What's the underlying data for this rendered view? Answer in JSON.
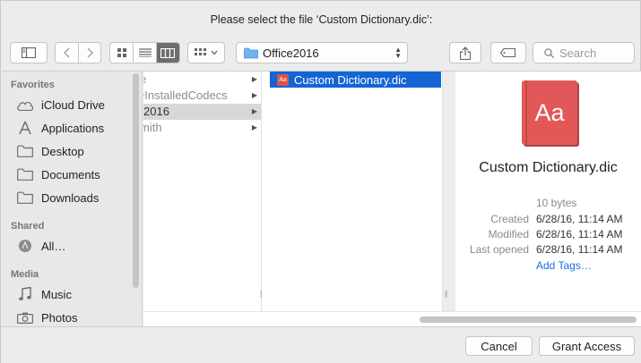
{
  "dialog": {
    "prompt": "Please select the file ‘Custom Dictionary.dic’:"
  },
  "toolbar": {
    "sidebar_toggle_icon": "sidebar-icon",
    "back_icon": "chevron-left-icon",
    "forward_icon": "chevron-right-icon",
    "views": [
      "icon-view",
      "list-view",
      "column-view"
    ],
    "active_view": "column-view",
    "arrange_icon": "grid-arrange-icon",
    "path_popup": {
      "label": "Office2016"
    },
    "share_icon": "share-icon",
    "tag_icon": "tag-icon",
    "search": {
      "placeholder": "Search"
    }
  },
  "sidebar": {
    "sections": [
      {
        "heading": "Favorites",
        "items": [
          {
            "label": "iCloud Drive",
            "icon": "cloud-icon"
          },
          {
            "label": "Applications",
            "icon": "applications-icon"
          },
          {
            "label": "Desktop",
            "icon": "folder-icon"
          },
          {
            "label": "Documents",
            "icon": "folder-icon"
          },
          {
            "label": "Downloads",
            "icon": "folder-icon"
          }
        ]
      },
      {
        "heading": "Shared",
        "items": [
          {
            "label": "All…",
            "icon": "network-icon"
          }
        ]
      },
      {
        "heading": "Media",
        "items": [
          {
            "label": "Music",
            "icon": "music-note-icon"
          },
          {
            "label": "Photos",
            "icon": "camera-icon"
          }
        ]
      }
    ]
  },
  "browser": {
    "column1": [
      {
        "label": "e",
        "selected": false
      },
      {
        "label": "eInstalledCodecs",
        "selected": false
      },
      {
        "label": "2016",
        "selected": true
      },
      {
        "label": "mith",
        "selected": false
      }
    ],
    "column2": [
      {
        "label": "Custom Dictionary.dic",
        "selected": true
      }
    ]
  },
  "preview": {
    "icon_text": "Aa",
    "name": "Custom Dictionary.dic",
    "size": "10 bytes",
    "meta": [
      {
        "key": "Created",
        "value": "6/28/16, 11:14 AM"
      },
      {
        "key": "Modified",
        "value": "6/28/16, 11:14 AM"
      },
      {
        "key": "Last opened",
        "value": "6/28/16, 11:14 AM"
      }
    ],
    "add_tags": "Add Tags…"
  },
  "footer": {
    "cancel": "Cancel",
    "grant": "Grant Access"
  },
  "colors": {
    "selection": "#1465d4",
    "accent_link": "#1a6fd8",
    "file_icon": "#e25858"
  }
}
